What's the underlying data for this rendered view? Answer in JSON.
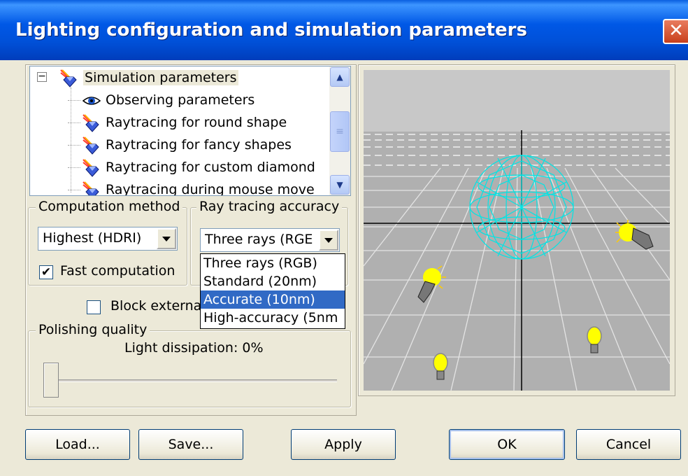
{
  "window": {
    "title": "Lighting configuration and simulation parameters",
    "close_symbol": "✕"
  },
  "tree": {
    "items": [
      {
        "label": "Simulation parameters",
        "icon": "gem-rainbow-icon"
      },
      {
        "label": "Observing parameters",
        "icon": "eye-icon"
      },
      {
        "label": "Raytracing for round shape",
        "icon": "gem-rainbow-icon"
      },
      {
        "label": "Raytracing for fancy shapes",
        "icon": "gem-rainbow-icon"
      },
      {
        "label": "Raytracing for custom diamond",
        "icon": "gem-rainbow-icon"
      },
      {
        "label": "Raytracing during mouse move",
        "icon": "gem-rainbow-icon"
      }
    ]
  },
  "computation_method": {
    "legend": "Computation method",
    "selected": "Highest (HDRI)",
    "fast_computation_label": "Fast computation",
    "fast_computation_checked": true
  },
  "ray_tracing_accuracy": {
    "legend": "Ray tracing accuracy",
    "selected": "Three rays (RGE",
    "options": [
      "Three rays (RGB)",
      "Standard (20nm)",
      "Accurate (10nm)",
      "High-accuracy (5nm"
    ],
    "highlighted_index": 2
  },
  "block_external": {
    "label": "Block externa",
    "checked": false
  },
  "polishing_quality": {
    "legend": "Polishing quality",
    "light_dissipation_label": "Light dissipation: 0%",
    "light_dissipation_value": 0
  },
  "buttons": {
    "load": "Load...",
    "save": "Save...",
    "apply": "Apply",
    "ok": "OK",
    "cancel": "Cancel"
  },
  "colors": {
    "titlebar": "#0054e3",
    "wireframe": "#00e5e5",
    "selection": "#316ac5",
    "light_bulb": "#ffff00"
  }
}
